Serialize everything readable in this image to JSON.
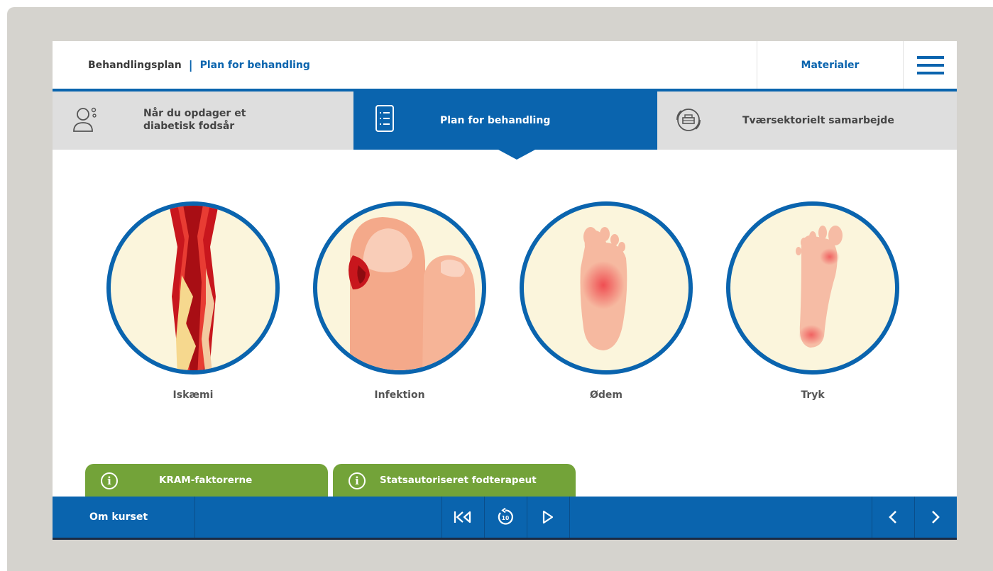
{
  "header": {
    "breadcrumb_root": "Behandlingsplan",
    "breadcrumb_separator": "|",
    "breadcrumb_current": "Plan for behandling",
    "materials_label": "Materialer",
    "menu_icon": "hamburger-icon"
  },
  "tabs": [
    {
      "label_line1": "Når du opdager et",
      "label_line2": "diabetisk fodsår",
      "icon": "person-icon",
      "active": false
    },
    {
      "label": "Plan for behandling",
      "icon": "checklist-icon",
      "active": true
    },
    {
      "label": "Tværsektorielt samarbejde",
      "icon": "collaboration-icon",
      "active": false
    }
  ],
  "conditions": [
    {
      "label": "Iskæmi",
      "icon": "blood-vessel-icon"
    },
    {
      "label": "Infektion",
      "icon": "infected-toe-icon"
    },
    {
      "label": "Ødem",
      "icon": "swollen-foot-icon"
    },
    {
      "label": "Tryk",
      "icon": "foot-pressure-icon"
    }
  ],
  "info_tabs": [
    {
      "label": "KRAM-faktorerne",
      "icon": "info-icon"
    },
    {
      "label": "Statsautoriseret fodterapeut",
      "icon": "info-icon"
    }
  ],
  "bottom_bar": {
    "about_label": "Om kurset",
    "replay_seconds": "10",
    "controls": [
      "restart-icon",
      "replay-10-icon",
      "play-icon"
    ],
    "nav": [
      "previous-icon",
      "next-icon"
    ]
  },
  "colors": {
    "primary_blue": "#0a64ae",
    "green": "#73a339",
    "frame_gray": "#d5d3ce",
    "circle_fill": "#fbf5dc"
  }
}
